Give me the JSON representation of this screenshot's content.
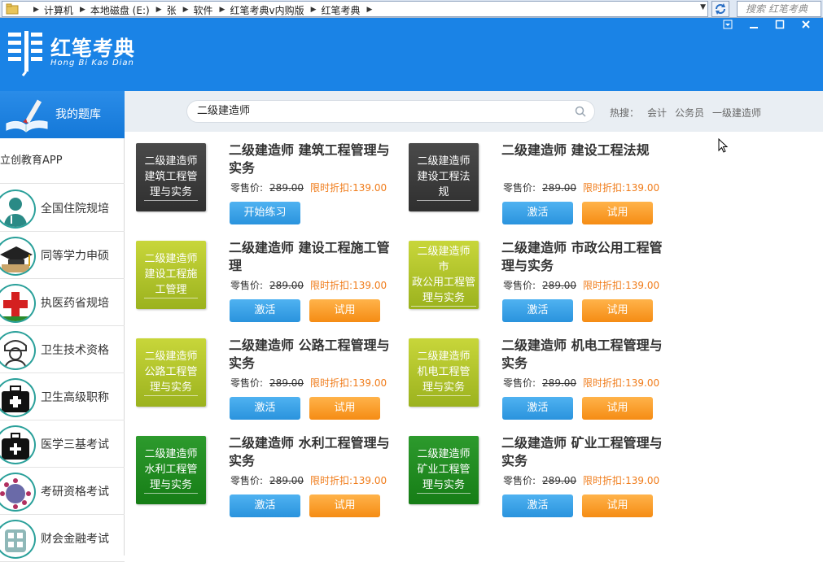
{
  "explorer": {
    "crumbs": [
      "计算机",
      "本地磁盘 (E:)",
      "张",
      "软件",
      "红笔考典v内购版",
      "红笔考典"
    ],
    "search_placeholder": "搜索 红笔考典"
  },
  "app": {
    "logo_title": "红笔考典",
    "logo_subtitle": "Hong Bi Kao Dian",
    "brand_color": "#1a83e6"
  },
  "sidebar": {
    "header_label": "我的题库",
    "app_label": "立创教育APP",
    "items": [
      {
        "label": "全国住院规培",
        "icon": "doctor-icon"
      },
      {
        "label": "同等学力申硕",
        "icon": "graduation-cap-icon"
      },
      {
        "label": "执医药省规培",
        "icon": "red-cross-icon"
      },
      {
        "label": "卫生技术资格",
        "icon": "nurse-icon"
      },
      {
        "label": "卫生高级职称",
        "icon": "first-aid-kit-icon"
      },
      {
        "label": "医学三基考试",
        "icon": "medical-bag-icon"
      },
      {
        "label": "考研资格考试",
        "icon": "virus-icon"
      },
      {
        "label": "财会金融考试",
        "icon": "calculator-icon"
      }
    ]
  },
  "search": {
    "value": "二级建造师",
    "hot_label": "热搜：",
    "hot_links": [
      "会计",
      "公务员",
      "一级建造师"
    ]
  },
  "price_labels": {
    "retail": "零售价:",
    "discount": "限时折扣:"
  },
  "books": [
    {
      "cover": "二级建造师\n建筑工程管\n理与实务",
      "color": "dark",
      "title": "二级建造师 建筑工程管理与实务",
      "orig": "289.00",
      "price": "139.00",
      "buttons": [
        "开始练习"
      ]
    },
    {
      "cover": "二级建造师\n建设工程法\n规",
      "color": "dark",
      "title": "二级建造师 建设工程法规",
      "orig": "289.00",
      "price": "139.00",
      "buttons": [
        "激活",
        "试用"
      ]
    },
    {
      "cover": "二级建造师\n建设工程施\n工管理",
      "color": "lime",
      "title": "二级建造师 建设工程施工管理",
      "orig": "289.00",
      "price": "139.00",
      "buttons": [
        "激活",
        "试用"
      ]
    },
    {
      "cover": "二级建造师 市\n政公用工程管\n理与实务",
      "color": "lime",
      "title": "二级建造师 市政公用工程管理与实务",
      "orig": "289.00",
      "price": "139.00",
      "buttons": [
        "激活",
        "试用"
      ]
    },
    {
      "cover": "二级建造师\n公路工程管\n理与实务",
      "color": "lime",
      "title": "二级建造师 公路工程管理与实务",
      "orig": "289.00",
      "price": "139.00",
      "buttons": [
        "激活",
        "试用"
      ]
    },
    {
      "cover": "二级建造师\n机电工程管\n理与实务",
      "color": "lime",
      "title": "二级建造师 机电工程管理与实务",
      "orig": "289.00",
      "price": "139.00",
      "buttons": [
        "激活",
        "试用"
      ]
    },
    {
      "cover": "二级建造师\n水利工程管\n理与实务",
      "color": "green",
      "title": "二级建造师 水利工程管理与实务",
      "orig": "289.00",
      "price": "139.00",
      "buttons": [
        "激活",
        "试用"
      ]
    },
    {
      "cover": "二级建造师\n矿业工程管\n理与实务",
      "color": "green",
      "title": "二级建造师 矿业工程管理与实务",
      "orig": "289.00",
      "price": "139.00",
      "buttons": [
        "激活",
        "试用"
      ]
    }
  ]
}
